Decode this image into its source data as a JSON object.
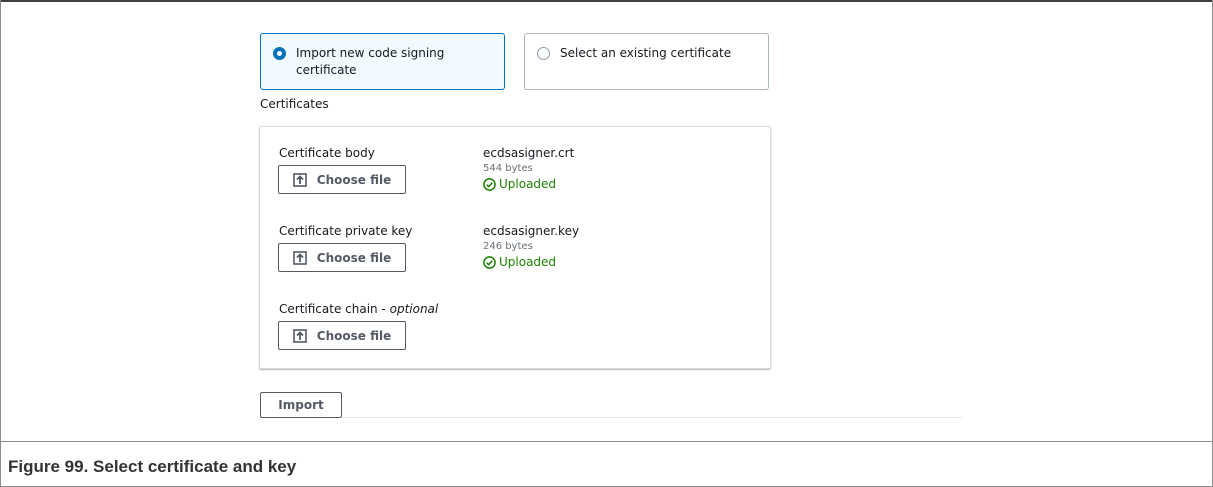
{
  "source_options": [
    {
      "label_line1": "Import new code signing",
      "label_line2": "certificate",
      "selected": true
    },
    {
      "label_line1": "Select an existing certificate",
      "selected": false
    }
  ],
  "certificates_section": {
    "label": "Certificates",
    "fields": [
      {
        "label": "Certificate body",
        "button_label": "Choose file",
        "file_name": "ecdsasigner.crt",
        "file_size": "544 bytes",
        "status": "Uploaded"
      },
      {
        "label": "Certificate private key",
        "button_label": "Choose file",
        "file_name": "ecdsasigner.key",
        "file_size": "246 bytes",
        "status": "Uploaded"
      },
      {
        "label": "Certificate chain - ",
        "label_optional": "optional",
        "button_label": "Choose file"
      }
    ]
  },
  "import_button_label": "Import",
  "figure_caption": "Figure 99.  Select certificate and key",
  "colors": {
    "accent": "#0073bb",
    "success": "#1d8102",
    "border": "#545b64"
  },
  "icons": {
    "radio_on": "radio-selected-icon",
    "radio_off": "radio-unselected-icon",
    "upload": "upload-icon",
    "status_ok": "check-circle-icon"
  }
}
